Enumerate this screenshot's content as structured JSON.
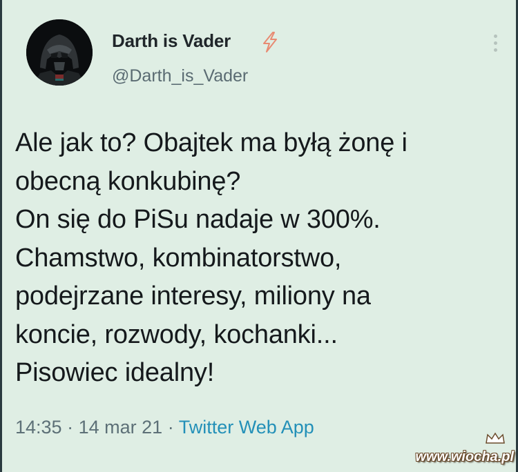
{
  "author": {
    "display_name": "Darth is Vader",
    "handle": "@Darth_is_Vader",
    "avatar_icon": "darth-vader-helmet-icon",
    "badge_icon": "lightning-bolt-icon",
    "badge_color": "#e88a72"
  },
  "tweet": {
    "lines": [
      "Ale jak to? Obajtek ma byłą żonę i",
      "obecną konkubinę?",
      "On się do PiSu nadaje w 300%.",
      "Chamstwo, kombinatorstwo,",
      "podejrzane interesy, miliony na",
      "koncie, rozwody, kochanki...",
      "Pisowiec idealny!"
    ]
  },
  "meta": {
    "time": "14:35",
    "separator": "·",
    "date": "14 mar 21",
    "source": "Twitter Web App",
    "source_color": "#2390b8"
  },
  "watermark": {
    "text": "www.wiocha.pl"
  },
  "colors": {
    "background": "#dfeee4",
    "text": "#15191c",
    "muted": "#5d7077"
  }
}
